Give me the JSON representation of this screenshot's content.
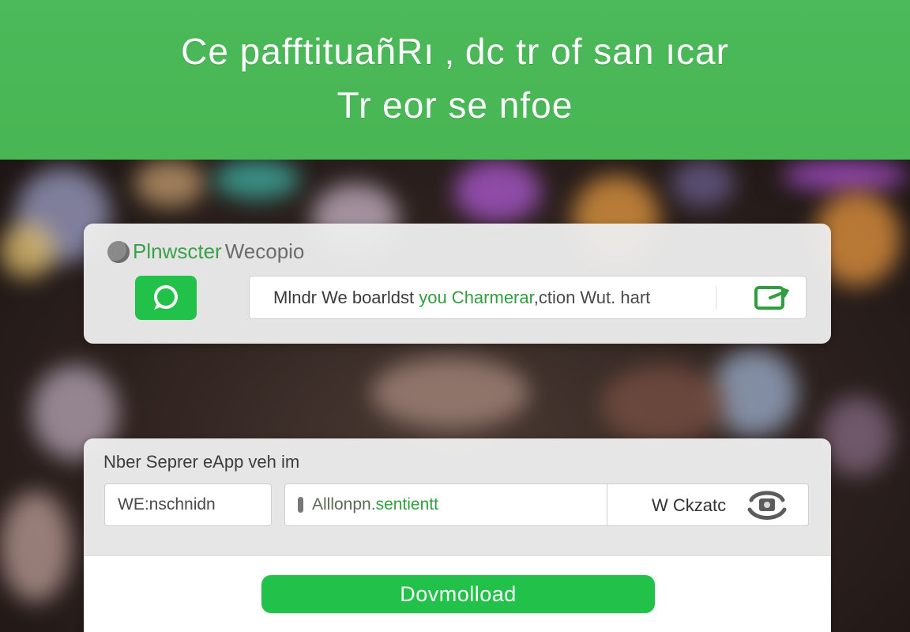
{
  "colors": {
    "header_green": "#4cb95a",
    "accent_green": "#22c14a",
    "text_green": "#2f9e3f"
  },
  "hero": {
    "line1": "Ce pafftituañRı ‚ dc tr of san ıcar",
    "line2": "Tr  eor se nfoe"
  },
  "card1": {
    "title_green": "Plnwscter",
    "title_grey": "Wecopio",
    "title_icon": "grey-circle-icon",
    "app_icon": "chat-bubble-icon",
    "message": {
      "part1": "Mlndr We boarldst ",
      "part2": "you Charmerar",
      "part3": ",ction Wut. hart"
    },
    "share_icon": "share-box-icon"
  },
  "card2": {
    "label": "Nber Seprer eApp veh im",
    "field_a_value": "WE:nschnidn",
    "field_b": {
      "part1": "Alllonpn.",
      "part2": "sentientt"
    },
    "ext_label": "W Ckzatc",
    "ext_icon": "contact-phone-icon",
    "download_label": "Dovmolload"
  }
}
